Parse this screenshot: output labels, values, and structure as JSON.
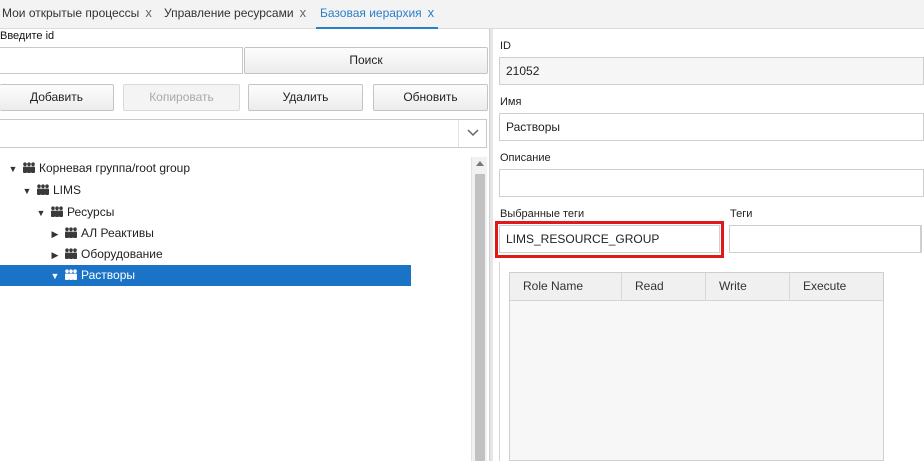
{
  "tabs": [
    {
      "label": "Мои открытые процессы",
      "close": "x"
    },
    {
      "label": "Управление ресурсами",
      "close": "x"
    },
    {
      "label": "Базовая иерархия",
      "close": "x"
    }
  ],
  "left": {
    "id_label": "Введите id",
    "id_value": "",
    "search_label": "Поиск",
    "buttons": {
      "add": "Добавить",
      "copy": "Копировать",
      "delete": "Удалить",
      "refresh": "Обновить"
    },
    "select_value": ""
  },
  "tree": [
    {
      "label": "Корневая группа/root group",
      "expanded": true
    },
    {
      "label": "LIMS",
      "expanded": true
    },
    {
      "label": "Ресурсы",
      "expanded": true
    },
    {
      "label": "АЛ Реактивы",
      "expanded": false
    },
    {
      "label": "Оборудование",
      "expanded": false
    },
    {
      "label": "Растворы",
      "expanded": true,
      "selected": true
    }
  ],
  "form": {
    "id_label": "ID",
    "id_value": "21052",
    "name_label": "Имя",
    "name_value": "Растворы",
    "desc_label": "Описание",
    "desc_value": "",
    "selected_tags_label": "Выбранные теги",
    "selected_tags_value": "LIMS_RESOURCE_GROUP",
    "tags_label": "Теги",
    "tags_value": ""
  },
  "grid": {
    "columns": [
      "Role Name",
      "Read",
      "Write",
      "Execute"
    ]
  },
  "colors": {
    "accent": "#2a7fc9",
    "selected": "#1b73c7",
    "highlight": "#e01818"
  }
}
